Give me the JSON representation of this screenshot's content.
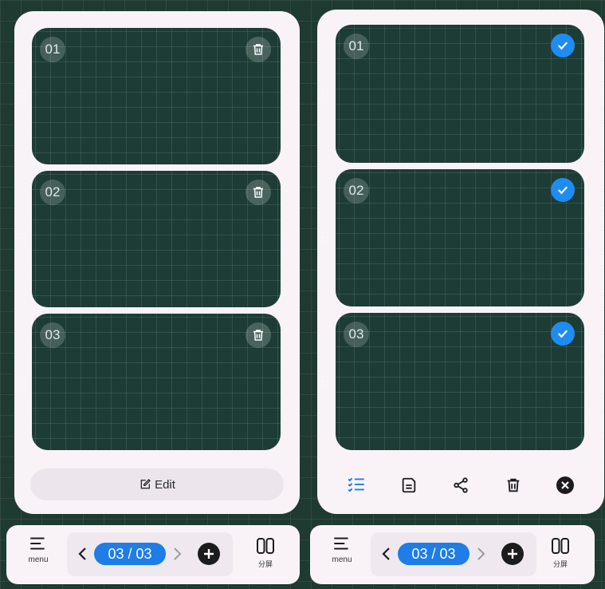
{
  "left_panel": {
    "pages": [
      {
        "number": "01",
        "icon": "trash-icon"
      },
      {
        "number": "02",
        "icon": "trash-icon"
      },
      {
        "number": "03",
        "icon": "trash-icon"
      }
    ],
    "edit_button": {
      "label": "Edit",
      "icon": "edit-icon"
    }
  },
  "right_panel": {
    "pages": [
      {
        "number": "01",
        "selected": true,
        "icon": "check-icon"
      },
      {
        "number": "02",
        "selected": true,
        "icon": "check-icon"
      },
      {
        "number": "03",
        "selected": true,
        "icon": "check-icon"
      }
    ],
    "actions": [
      {
        "name": "select-all",
        "icon": "checklist-icon"
      },
      {
        "name": "save",
        "icon": "save-icon"
      },
      {
        "name": "share",
        "icon": "share-icon"
      },
      {
        "name": "delete",
        "icon": "trash-icon"
      },
      {
        "name": "close",
        "icon": "close-icon"
      }
    ]
  },
  "bottom_bar": {
    "menu_label": "menu",
    "page_indicator": "03 / 03",
    "split_label": "分屏"
  },
  "colors": {
    "accent": "#1e7de6",
    "panel": "#f9f3f8",
    "canvas": "#1d3c35"
  }
}
